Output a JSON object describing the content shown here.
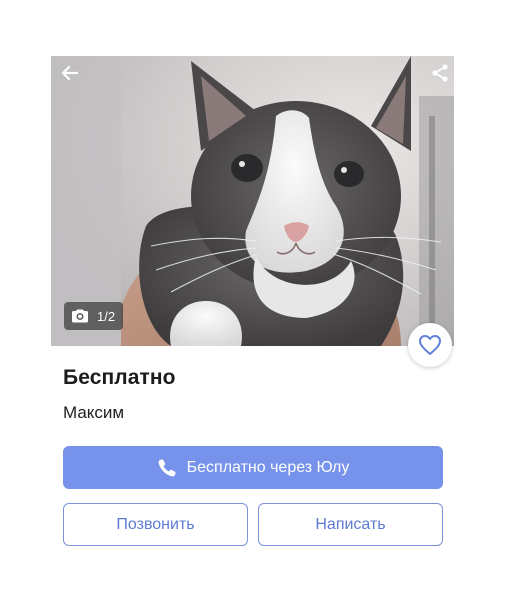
{
  "listing": {
    "photo": {
      "counter": "1/2",
      "subject": "kitten"
    },
    "price": "Бесплатно",
    "seller_name": "Максим"
  },
  "actions": {
    "primary_label": "Бесплатно через Юлу",
    "call_label": "Позвонить",
    "message_label": "Написать"
  },
  "icons": {
    "back": "arrow-left-icon",
    "share": "share-icon",
    "camera": "camera-icon",
    "favorite": "heart-icon",
    "phone": "phone-icon"
  },
  "colors": {
    "accent": "#7692ea",
    "outline": "#7a93d9",
    "outline_text": "#5d7bd2"
  }
}
